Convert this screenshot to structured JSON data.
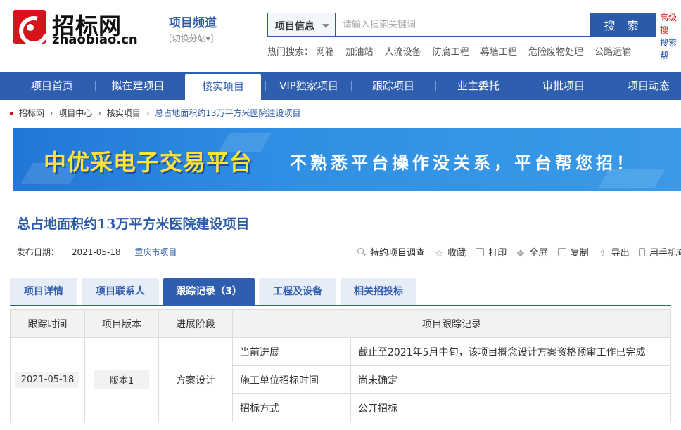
{
  "header": {
    "logo_cn": "招标网",
    "logo_en": "zhaobiao.cn",
    "channel_title": "项目频道",
    "channel_switch": "[切换分站▾]",
    "search": {
      "type_label": "项目信息",
      "placeholder": "请输入搜索关键词",
      "button_label": "搜 索",
      "advanced_1": "高级搜",
      "advanced_2": "搜索帮"
    },
    "hot": {
      "label": "热门搜索：",
      "keywords": [
        "网箱",
        "加油站",
        "人流设备",
        "防腐工程",
        "幕墙工程",
        "危险废物处理",
        "公路运输"
      ]
    }
  },
  "nav": {
    "items": [
      "项目首页",
      "拟在建项目",
      "核实项目",
      "VIP独家项目",
      "跟踪项目",
      "业主委托",
      "审批项目",
      "项目动态"
    ],
    "active_index": 2
  },
  "breadcrumb": {
    "items": [
      "招标网",
      "项目中心",
      "核实项目"
    ],
    "current": "总占地面积约13万平方米医院建设项目"
  },
  "banner": {
    "title": "中优采电子交易平台",
    "subtitle": "不熟悉平台操作没关系，平台帮您招！"
  },
  "project": {
    "title": "总占地面积约13万平方米医院建设项目",
    "publish_label": "发布日期：",
    "publish_date": "2021-05-18",
    "region": "重庆市项目"
  },
  "tools": {
    "survey": "特约项目调查",
    "favorite": "收藏",
    "print": "打印",
    "fullscreen": "全屏",
    "copy": "复制",
    "export": "导出",
    "mobile": "用手机查看"
  },
  "tabs": {
    "items": [
      "项目详情",
      "项目联系人",
      "跟踪记录（3）",
      "工程及设备",
      "相关招投标"
    ],
    "active_index": 2
  },
  "table": {
    "headers": [
      "跟踪时间",
      "项目版本",
      "进展阶段",
      "项目跟踪记录"
    ],
    "track_time": "2021-05-18",
    "version": "版本1",
    "stage": "方案设计",
    "records": [
      {
        "label": "当前进展",
        "value": "截止至2021年5月中旬，该项目概念设计方案资格预审工作已完成"
      },
      {
        "label": "施工单位招标时间",
        "value": "尚未确定"
      },
      {
        "label": "招标方式",
        "value": "公开招标"
      }
    ]
  },
  "colors": {
    "brand_red": "#d7141c",
    "nav_blue": "#2f5eae",
    "banner_yellow": "#ffe23a"
  }
}
